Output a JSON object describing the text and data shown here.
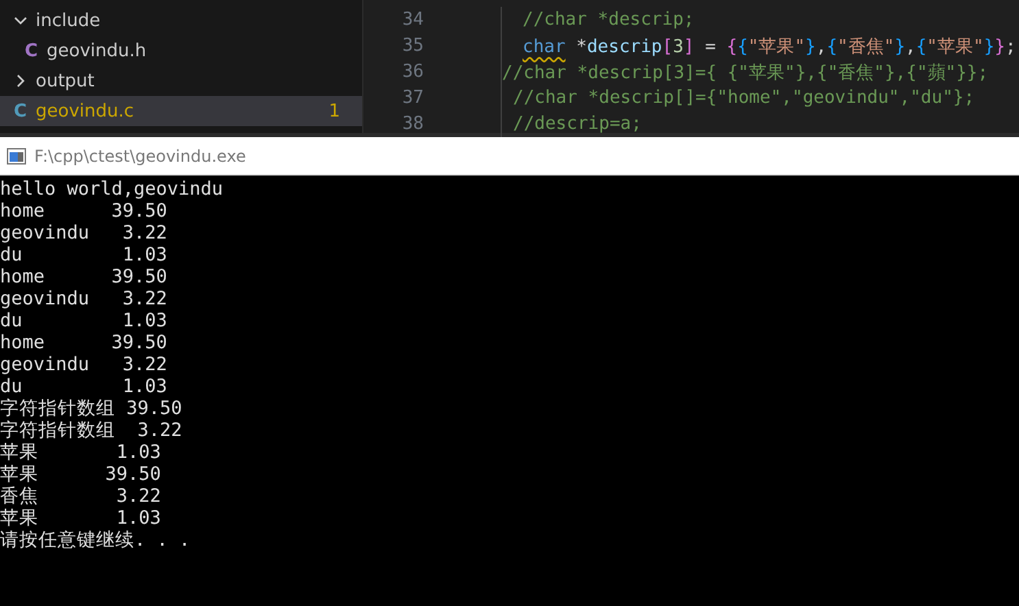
{
  "explorer": {
    "items": [
      {
        "label": "include",
        "kind": "folder",
        "expanded": true,
        "selected": false,
        "children": [
          {
            "label": "geovindu.h",
            "kind": "header",
            "icon": "C",
            "selected": false
          }
        ]
      },
      {
        "label": "output",
        "kind": "folder",
        "expanded": false,
        "selected": false
      },
      {
        "label": "geovindu.c",
        "kind": "source",
        "icon": "C",
        "selected": true,
        "badge": "1"
      }
    ]
  },
  "editor": {
    "lines": [
      {
        "number": "34",
        "kind": "deep",
        "tokens": [
          {
            "kind": "comment",
            "text": "//char *descrip;"
          }
        ]
      },
      {
        "number": "35",
        "kind": "deep",
        "tokens": [
          {
            "kind": "keyword",
            "text": "char",
            "squiggle": true
          },
          {
            "kind": "punct",
            "text": " *"
          },
          {
            "kind": "variable",
            "text": "descrip"
          },
          {
            "kind": "bracket1",
            "text": "["
          },
          {
            "kind": "number",
            "text": "3"
          },
          {
            "kind": "bracket1",
            "text": "]"
          },
          {
            "kind": "punct",
            "text": " = "
          },
          {
            "kind": "bracket1",
            "text": "{"
          },
          {
            "kind": "bracket2",
            "text": "{"
          },
          {
            "kind": "string",
            "text": "\"苹果\""
          },
          {
            "kind": "bracket2",
            "text": "}"
          },
          {
            "kind": "punct",
            "text": ","
          },
          {
            "kind": "bracket2",
            "text": "{"
          },
          {
            "kind": "string",
            "text": "\"香焦\""
          },
          {
            "kind": "bracket2",
            "text": "}"
          },
          {
            "kind": "punct",
            "text": ","
          },
          {
            "kind": "bracket2",
            "text": "{"
          },
          {
            "kind": "string",
            "text": "\"苹果\""
          },
          {
            "kind": "bracket2",
            "text": "}"
          },
          {
            "kind": "bracket1",
            "text": "}"
          },
          {
            "kind": "punct",
            "text": ";"
          }
        ]
      },
      {
        "number": "36",
        "kind": "flush",
        "tokens": [
          {
            "kind": "comment",
            "text": "//char *descrip[3]={ {\"苹果\"},{\"香焦\"},{\"蘋\"}};"
          }
        ]
      },
      {
        "number": "37",
        "kind": "shallow",
        "tokens": [
          {
            "kind": "comment",
            "text": "//char *descrip[]={\"home\",\"geovindu\",\"du\"};"
          }
        ]
      },
      {
        "number": "38",
        "kind": "shallow",
        "tokens": [
          {
            "kind": "comment",
            "text": "//descrip=a;"
          }
        ]
      }
    ]
  },
  "console_window": {
    "title": "F:\\cpp\\ctest\\geovindu.exe",
    "output": [
      "hello world,geovindu",
      "home      39.50",
      "geovindu   3.22",
      "du         1.03",
      "home      39.50",
      "geovindu   3.22",
      "du         1.03",
      "home      39.50",
      "geovindu   3.22",
      "du         1.03",
      "字符指针数组 39.50",
      "字符指针数组  3.22",
      "苹果       1.03",
      "苹果      39.50",
      "香焦       3.22",
      "苹果       1.03",
      "请按任意键继续. . ."
    ]
  }
}
